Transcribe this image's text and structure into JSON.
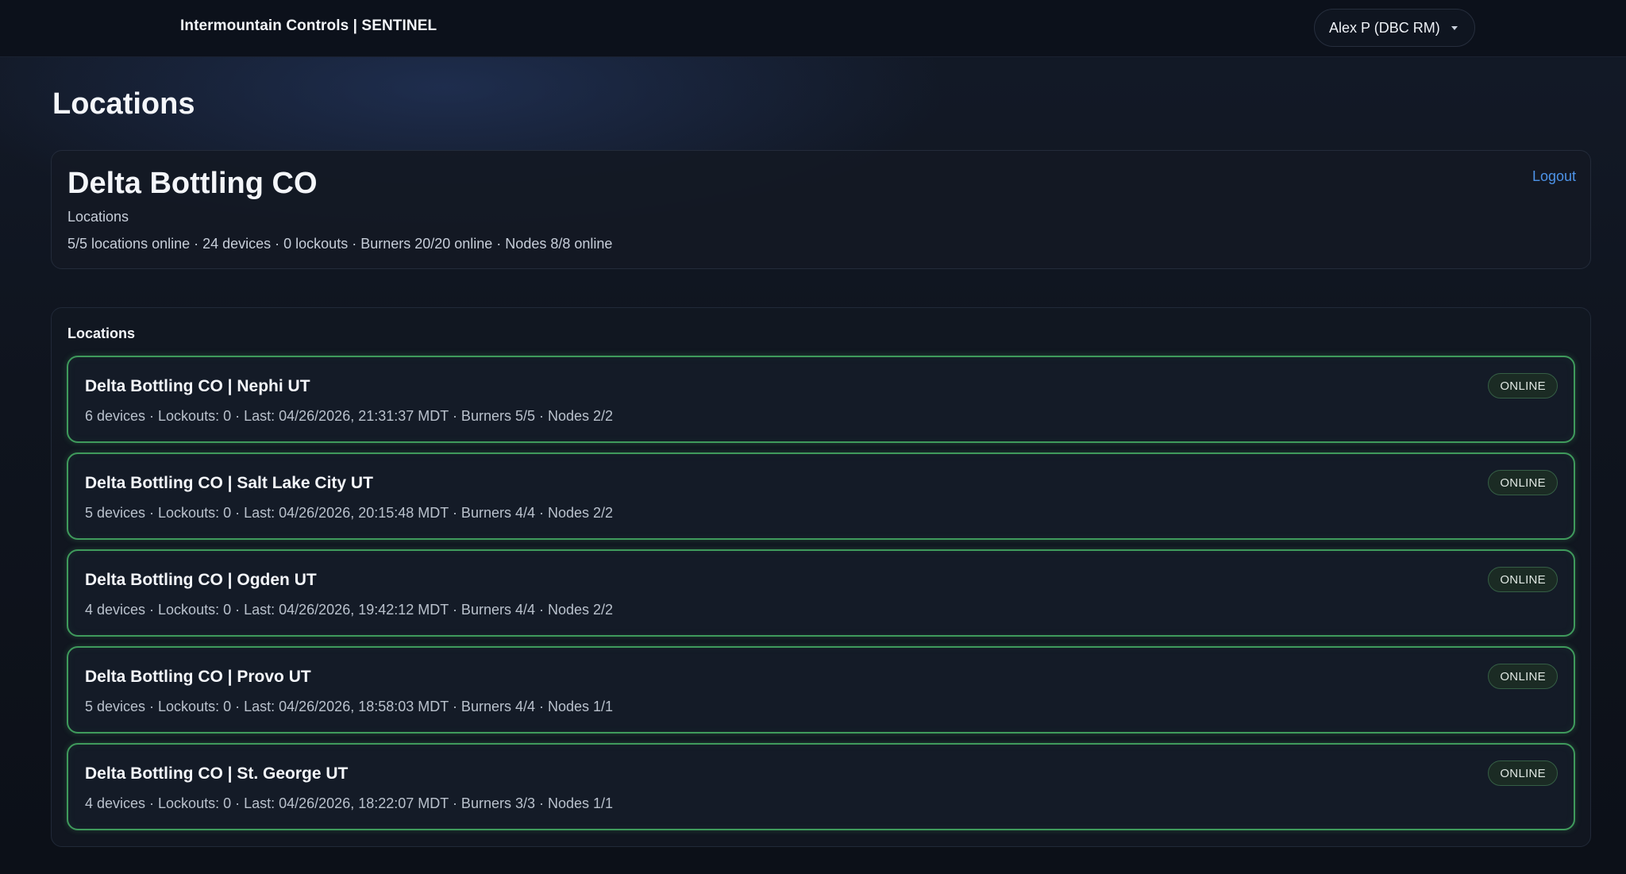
{
  "app": {
    "brand": "Intermountain Controls | SENTINEL",
    "user_label": "Alex P (DBC RM)"
  },
  "page": {
    "title": "Locations"
  },
  "summary": {
    "org_name": "Delta Bottling CO",
    "subtitle": "Locations",
    "stats": "5/5 locations online · 24 devices · 0 lockouts · Burners 20/20 online · Nodes 8/8 online",
    "logout_label": "Logout"
  },
  "locations": {
    "heading": "Locations",
    "items": [
      {
        "name": "Delta Bottling CO | Nephi UT",
        "meta": "6 devices · Lockouts: 0 · Last: 04/26/2026, 21:31:37 MDT · Burners 5/5 · Nodes 2/2",
        "status": "ONLINE"
      },
      {
        "name": "Delta Bottling CO | Salt Lake City UT",
        "meta": "5 devices · Lockouts: 0 · Last: 04/26/2026, 20:15:48 MDT · Burners 4/4 · Nodes 2/2",
        "status": "ONLINE"
      },
      {
        "name": "Delta Bottling CO | Ogden UT",
        "meta": "4 devices · Lockouts: 0 · Last: 04/26/2026, 19:42:12 MDT · Burners 4/4 · Nodes 2/2",
        "status": "ONLINE"
      },
      {
        "name": "Delta Bottling CO | Provo UT",
        "meta": "5 devices · Lockouts: 0 · Last: 04/26/2026, 18:58:03 MDT · Burners 4/4 · Nodes 1/1",
        "status": "ONLINE"
      },
      {
        "name": "Delta Bottling CO | St. George UT",
        "meta": "4 devices · Lockouts: 0 · Last: 04/26/2026, 18:22:07 MDT · Burners 3/3 · Nodes 1/1",
        "status": "ONLINE"
      }
    ]
  },
  "colors": {
    "background": "#0f141e",
    "online_border": "#3f9a5c",
    "link": "#4d93e8"
  },
  "icons": {
    "user_menu_caret": "caret-down-icon"
  }
}
